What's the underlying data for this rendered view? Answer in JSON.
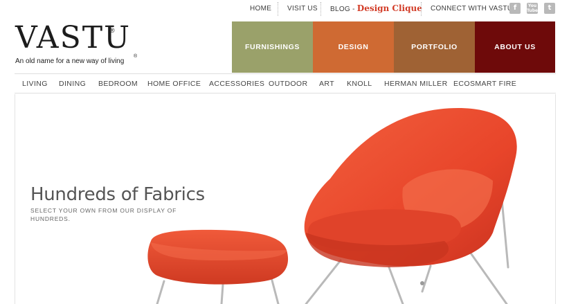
{
  "top_nav": {
    "home": "HOME",
    "visit_us": "VISIT US",
    "blog_prefix": "BLOG - ",
    "blog_name": "Design Clique",
    "connect": "CONNECT WITH VASTU",
    "social": [
      {
        "name": "facebook-icon",
        "glyph": "f"
      },
      {
        "name": "youtube-icon",
        "glyph": "You Tube"
      },
      {
        "name": "twitter-icon",
        "glyph": "t"
      }
    ]
  },
  "logo": {
    "wordmark": "VASTU",
    "registered": "®",
    "tagline": "An old name for a new way of living",
    "tagline_registered": "®"
  },
  "main_nav": [
    {
      "label": "FURNISHINGS",
      "color": "#9aa16a"
    },
    {
      "label": "DESIGN",
      "color": "#cf6a33"
    },
    {
      "label": "PORTFOLIO",
      "color": "#9f6234"
    },
    {
      "label": "ABOUT US",
      "color": "#6e0a0a"
    }
  ],
  "sub_nav": [
    "LIVING",
    "DINING",
    "BEDROOM",
    "HOME OFFICE",
    "ACCESSORIES",
    "OUTDOOR",
    "ART",
    "KNOLL",
    "HERMAN MILLER",
    "ECOSMART FIRE"
  ],
  "hero": {
    "title": "Hundreds of Fabrics",
    "subtitle": "SELECT YOUR OWN FROM OUR DISPLAY OF HUNDREDS.",
    "product_color": "#ec4a2c"
  }
}
